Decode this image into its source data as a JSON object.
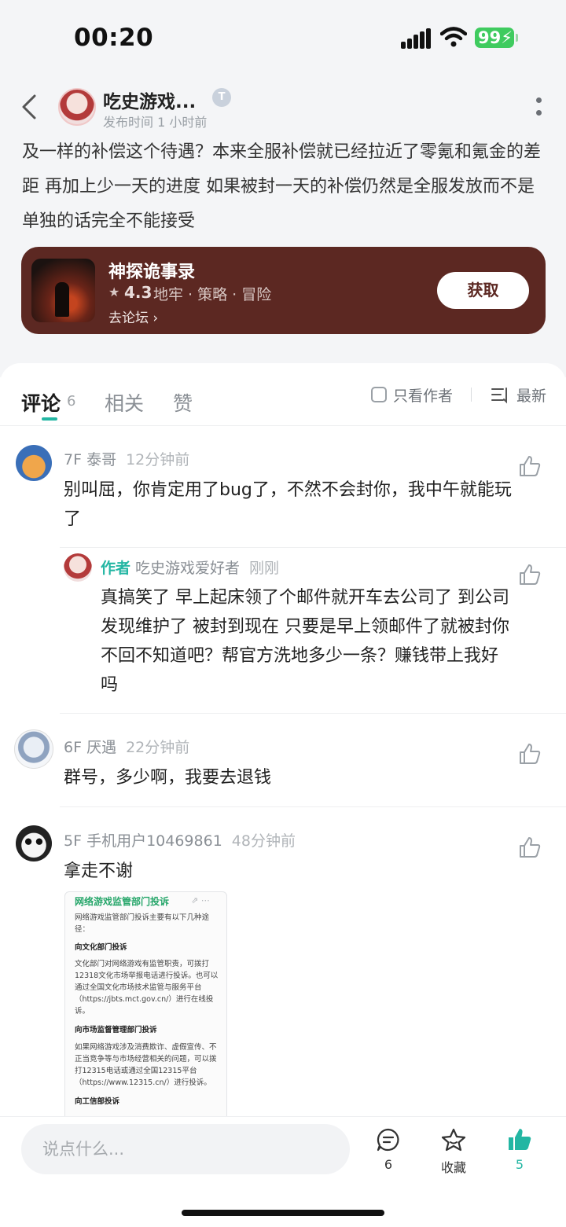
{
  "status_bar": {
    "time": "00:20",
    "battery": "99"
  },
  "header": {
    "author_name": "吃史游戏...",
    "badge": "T",
    "post_time": "发布时间 1 小时前"
  },
  "post": {
    "text": "及一样的补偿这个待遇？本来全服补偿就已经拉近了零氪和氪金的差距 再加上少一天的进度 如果被封一天的补偿仍然是全服发放而不是单独的话完全不能接受"
  },
  "game_card": {
    "title": "神探诡事录",
    "rating": "4.3",
    "tags": "地牢 · 策略 · 冒险",
    "forum_link": "去论坛",
    "get_label": "获取",
    "color": "#5c2822"
  },
  "tabs": {
    "comments": "评论",
    "comments_count": "6",
    "related": "相关",
    "likes": "赞",
    "only_author": "只看作者",
    "sort": "最新",
    "accent_color": "#23b6a3"
  },
  "comments": [
    {
      "floor": "7F",
      "user": "泰哥",
      "time": "12分钟前",
      "text": "别叫屈，你肯定用了bug了，不然不会封你，我中午就能玩了"
    },
    {
      "tag": "作者",
      "user": "吃史游戏爱好者",
      "time": "刚刚",
      "text": "真搞笑了 早上起床领了个邮件就开车去公司了 到公司发现维护了 被封到现在 只要是早上领邮件了就被封你不回不知道吧？帮官方洗地多少一条？赚钱带上我好吗"
    },
    {
      "floor": "6F",
      "user": "厌遇",
      "time": "22分钟前",
      "text": "群号，多少啊，我要去退钱"
    },
    {
      "floor": "5F",
      "user": "手机用户10469861",
      "time": "48分钟前",
      "text": "拿走不谢"
    }
  ],
  "attachment": {
    "title": "网络游戏监管部门投诉",
    "p1": "网络游戏监管部门投诉主要有以下几种途径：",
    "h1": "向文化部门投诉",
    "p2": "文化部门对网络游戏有监管职责，可拨打12318文化市场举报电话进行投诉。也可以通过全国文化市场技术监管与服务平台（https://jbts.mct.gov.cn/）进行在线投诉。",
    "h2": "向市场监督管理部门投诉",
    "p3": "如果网络游戏涉及消费欺诈、虚假宣传、不正当竞争等与市场经营相关的问题，可以拨打12315电话或通过全国12315平台（https://www.12315.cn/）进行投诉。",
    "h3": "向工信部投诉"
  },
  "bottom_bar": {
    "input_placeholder": "说点什么...",
    "comment_count": "6",
    "favorite_label": "收藏",
    "like_count": "5"
  }
}
